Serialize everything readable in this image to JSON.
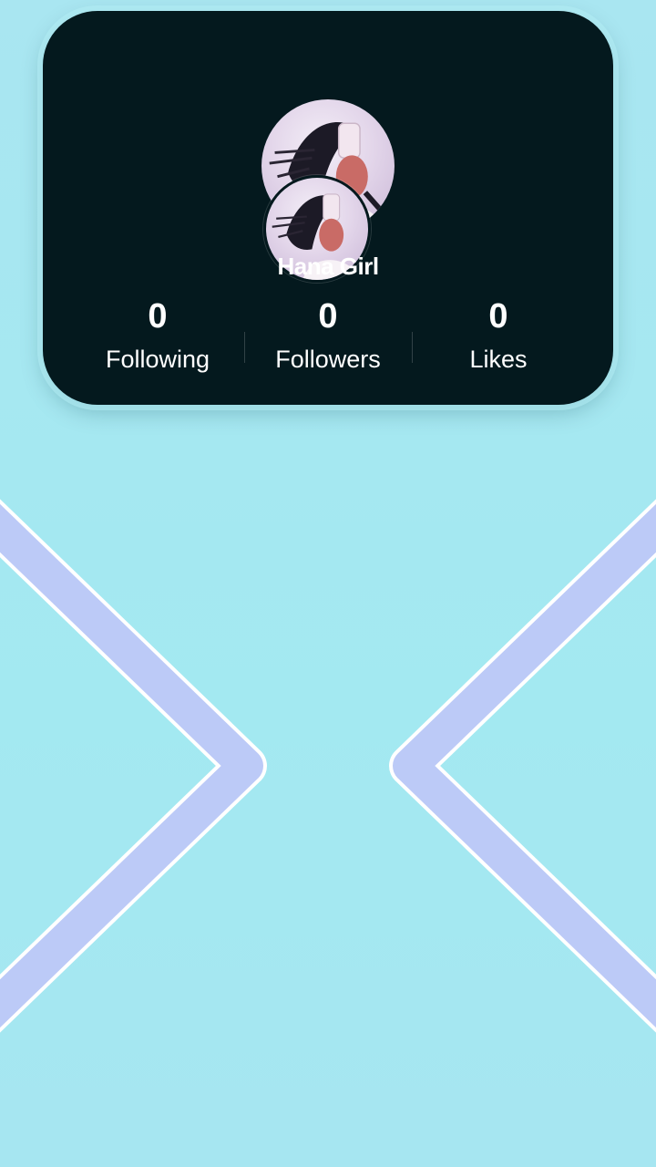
{
  "profile": {
    "username": "Hana Girl"
  },
  "stats": [
    {
      "value": "0",
      "label": "Following"
    },
    {
      "value": "0",
      "label": "Followers"
    },
    {
      "value": "0",
      "label": "Likes"
    }
  ],
  "colors": {
    "background": "#a6e6f1",
    "card": "#04191e",
    "chevron": "#bccaf7",
    "text": "#ffffff"
  },
  "icons": {
    "decoration": "chevron-shapes"
  }
}
